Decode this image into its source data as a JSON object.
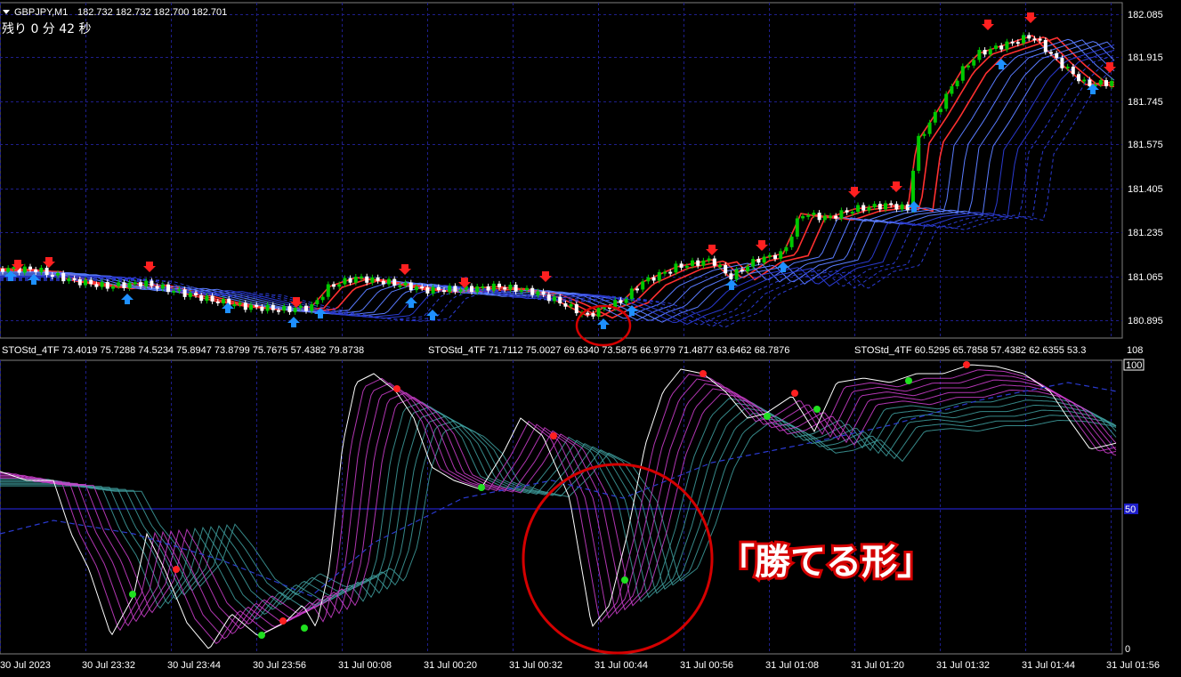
{
  "header": {
    "symbol": "GBPJPY,M1",
    "ohlc": "182.732 182.732 182.700 182.701",
    "timer": "残り 0 分 42 秒"
  },
  "main_axis_labels": [
    "182.085",
    "181.915",
    "181.745",
    "181.575",
    "181.405",
    "181.235",
    "181.065",
    "180.895"
  ],
  "indicator": {
    "label_1": "STOStd_4TF 73.4019 75.7288 74.5234 75.8947 73.8799 75.7675 57.4382 79.8738",
    "label_2": "STOStd_4TF 71.7112 75.0027 69.6340 73.5875 66.9779 71.4877 63.6462 68.7876",
    "label_3": "STOStd_4TF 60.5295 65.7858 57.4382 62.6355 53.3",
    "axis_top": "108",
    "axis_100": "100",
    "axis_50": "50",
    "axis_0": "0"
  },
  "time_labels": [
    "30 Jul 2023",
    "30 Jul 23:32",
    "30 Jul 23:44",
    "30 Jul 23:56",
    "31 Jul 00:08",
    "31 Jul 00:20",
    "31 Jul 00:32",
    "31 Jul 00:44",
    "31 Jul 00:56",
    "31 Jul 01:08",
    "31 Jul 01:20",
    "31 Jul 01:32",
    "31 Jul 01:44",
    "31 Jul 01:56"
  ],
  "annotation": "「勝てる形」",
  "colors": {
    "background": "#000000",
    "grid": "#1e1e8c",
    "bull_candle": "#00c800",
    "bear_candle": "#ffffff",
    "sell_arrow": "#ff2020",
    "buy_arrow": "#1e90ff",
    "annotation_red": "#d40000",
    "fast_line": "#ffffff",
    "ribbon_magenta": "#d040d0",
    "ribbon_teal": "#40a0a0"
  }
}
